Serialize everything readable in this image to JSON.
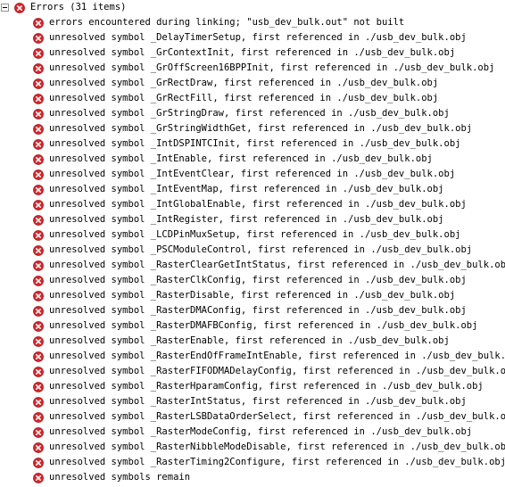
{
  "problems": {
    "root_label": "Errors (31 items)",
    "items": [
      "errors encountered during linking; \"usb_dev_bulk.out\" not built",
      "unresolved symbol _DelayTimerSetup, first referenced in ./usb_dev_bulk.obj",
      "unresolved symbol _GrContextInit, first referenced in ./usb_dev_bulk.obj",
      "unresolved symbol _GrOffScreen16BPPInit, first referenced in ./usb_dev_bulk.obj",
      "unresolved symbol _GrRectDraw, first referenced in ./usb_dev_bulk.obj",
      "unresolved symbol _GrRectFill, first referenced in ./usb_dev_bulk.obj",
      "unresolved symbol _GrStringDraw, first referenced in ./usb_dev_bulk.obj",
      "unresolved symbol _GrStringWidthGet, first referenced in ./usb_dev_bulk.obj",
      "unresolved symbol _IntDSPINTCInit, first referenced in ./usb_dev_bulk.obj",
      "unresolved symbol _IntEnable, first referenced in ./usb_dev_bulk.obj",
      "unresolved symbol _IntEventClear, first referenced in ./usb_dev_bulk.obj",
      "unresolved symbol _IntEventMap, first referenced in ./usb_dev_bulk.obj",
      "unresolved symbol _IntGlobalEnable, first referenced in ./usb_dev_bulk.obj",
      "unresolved symbol _IntRegister, first referenced in ./usb_dev_bulk.obj",
      "unresolved symbol _LCDPinMuxSetup, first referenced in ./usb_dev_bulk.obj",
      "unresolved symbol _PSCModuleControl, first referenced in ./usb_dev_bulk.obj",
      "unresolved symbol _RasterClearGetIntStatus, first referenced in ./usb_dev_bulk.obj",
      "unresolved symbol _RasterClkConfig, first referenced in ./usb_dev_bulk.obj",
      "unresolved symbol _RasterDisable, first referenced in ./usb_dev_bulk.obj",
      "unresolved symbol _RasterDMAConfig, first referenced in ./usb_dev_bulk.obj",
      "unresolved symbol _RasterDMAFBConfig, first referenced in ./usb_dev_bulk.obj",
      "unresolved symbol _RasterEnable, first referenced in ./usb_dev_bulk.obj",
      "unresolved symbol _RasterEndOfFrameIntEnable, first referenced in ./usb_dev_bulk.obj",
      "unresolved symbol _RasterFIFODMADelayConfig, first referenced in ./usb_dev_bulk.obj",
      "unresolved symbol _RasterHparamConfig, first referenced in ./usb_dev_bulk.obj",
      "unresolved symbol _RasterIntStatus, first referenced in ./usb_dev_bulk.obj",
      "unresolved symbol _RasterLSBDataOrderSelect, first referenced in ./usb_dev_bulk.obj",
      "unresolved symbol _RasterModeConfig, first referenced in ./usb_dev_bulk.obj",
      "unresolved symbol _RasterNibbleModeDisable, first referenced in ./usb_dev_bulk.obj",
      "unresolved symbol _RasterTiming2Configure, first referenced in ./usb_dev_bulk.obj",
      "unresolved symbols remain"
    ]
  },
  "icons": {
    "expander": "collapse-minus-icon",
    "item": "error-icon"
  },
  "colors": {
    "error_red": "#d8262b",
    "error_red_dark": "#a3161a",
    "expander_border": "#919191"
  }
}
